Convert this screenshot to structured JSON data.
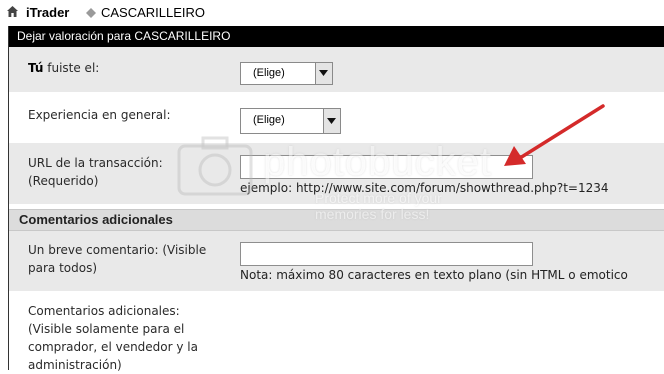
{
  "breadcrumb": {
    "site": "iTrader",
    "current": "CASCARILLEIRO"
  },
  "form": {
    "header": "Dejar valoración para CASCARILLEIRO",
    "role": {
      "label_bold": "Tú",
      "label_rest": " fuiste el:",
      "value": "(Elige)"
    },
    "experience": {
      "label": "Experiencia en general:",
      "value": "(Elige)"
    },
    "url": {
      "label_line1": "URL de la transacción:",
      "label_line2": "(Requerido)",
      "value": "",
      "hint": "ejemplo: http://www.site.com/forum/showthread.php?t=1234"
    },
    "section_title": "Comentarios adicionales",
    "brief_comment": {
      "label_line1": "Un breve comentario: (Visible",
      "label_line2": "para todos)",
      "value": "",
      "hint": "Nota: máximo 80 caracteres en texto plano (sin HTML o emotico"
    },
    "extra_comments": {
      "label_line1": "Comentarios adicionales:",
      "label_line2": "(Visible solamente para el",
      "label_line3": "comprador, el vendedor y la",
      "label_line4": "administración)"
    }
  },
  "watermark": {
    "text": "photobucket",
    "subtext": "Protect more of your memories for less!"
  },
  "colors": {
    "header_bg": "#000000",
    "row_bg": "#e9e9e9",
    "section_bg": "#dcdcdc",
    "annotation_arrow": "#d42a2a"
  }
}
